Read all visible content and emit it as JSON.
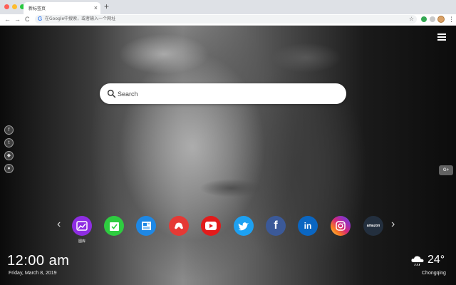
{
  "browser": {
    "tab_title": "新标签页",
    "tab_close": "×",
    "new_tab": "+",
    "back": "←",
    "forward": "→",
    "reload": "C",
    "omnibox_brand": "G",
    "omnibox_placeholder": "在Google中搜索，或者输入一个网址",
    "bookmark_star": "☆",
    "menu": "⋮",
    "traffic_colors": [
      "#ff5f57",
      "#febc2e",
      "#28c840"
    ]
  },
  "search": {
    "placeholder": "Search"
  },
  "social_side": [
    {
      "icon": "facebook-icon",
      "glyph": "f"
    },
    {
      "icon": "twitter-icon",
      "glyph": "t"
    },
    {
      "icon": "ghost-icon",
      "glyph": "◆"
    },
    {
      "icon": "wechat-icon",
      "glyph": "●"
    }
  ],
  "side_right": {
    "label": "G+"
  },
  "nav": {
    "prev": "‹",
    "next": "›"
  },
  "shortcuts": [
    {
      "name": "图库",
      "icon": "photo-icon",
      "color": "#8e2de2",
      "glyph": "🖼"
    },
    {
      "name": "",
      "icon": "calendar-check-icon",
      "color": "#2ecc40",
      "glyph": "✓"
    },
    {
      "name": "",
      "icon": "news-icon",
      "color": "#1e88e5",
      "glyph": "▤"
    },
    {
      "name": "",
      "icon": "game-icon",
      "color": "#e53935",
      "glyph": "🎮"
    },
    {
      "name": "",
      "icon": "youtube-icon",
      "color": "#e21b1b",
      "glyph": "▶"
    },
    {
      "name": "",
      "icon": "twitter-icon",
      "color": "#1da1f2",
      "glyph": "🐦"
    },
    {
      "name": "",
      "icon": "facebook-icon",
      "color": "#3b5998",
      "glyph": "f"
    },
    {
      "name": "",
      "icon": "linkedin-icon",
      "color": "#0a66c2",
      "glyph": "in"
    },
    {
      "name": "",
      "icon": "instagram-icon",
      "color": "#d6249f",
      "glyph": "◎"
    },
    {
      "name": "",
      "icon": "amazon-icon",
      "color": "#232f3e",
      "glyph": "amazon"
    }
  ],
  "clock": {
    "time": "12:00 am",
    "date": "Friday, March 8, 2019"
  },
  "weather": {
    "temp": "24°",
    "city": "Chongqing",
    "icon": "cloud-rain-icon"
  }
}
